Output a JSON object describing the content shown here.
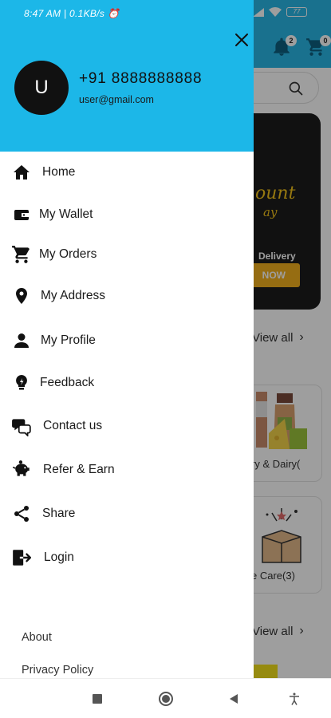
{
  "status_bar": {
    "time": "8:47 AM | 0.1KB/s ⏰",
    "battery": "77"
  },
  "header": {
    "notification_count": "2",
    "cart_count": "0"
  },
  "background": {
    "banner_script": "ount",
    "banner_script_sub": "ay",
    "banner_subtitle": "Delivery",
    "banner_button": "NOW",
    "view_all_1": "View all",
    "view_all_2": "View all",
    "category_1": "ry & Dairy(",
    "category_2": "e Care(3)"
  },
  "drawer": {
    "avatar_initial": "U",
    "phone": "+91 8888888888",
    "email": "user@gmail.com",
    "menu": [
      {
        "label": "Home",
        "icon": "home-icon"
      },
      {
        "label": "My Wallet",
        "icon": "wallet-icon"
      },
      {
        "label": "My Orders",
        "icon": "cart-icon"
      },
      {
        "label": "My Address",
        "icon": "location-pin-icon"
      },
      {
        "label": "My Profile",
        "icon": "person-icon"
      },
      {
        "label": "Feedback",
        "icon": "feedback-bulb-icon"
      },
      {
        "label": "Contact us",
        "icon": "chat-icon"
      },
      {
        "label": "Refer & Earn",
        "icon": "piggy-bank-icon"
      },
      {
        "label": "Share",
        "icon": "share-icon"
      },
      {
        "label": "Login",
        "icon": "login-icon"
      }
    ],
    "footer": {
      "about": "About",
      "privacy": "Privacy Policy"
    }
  },
  "colors": {
    "header_bg": "#1cb7e8",
    "banner_accent": "#f2b01e"
  }
}
